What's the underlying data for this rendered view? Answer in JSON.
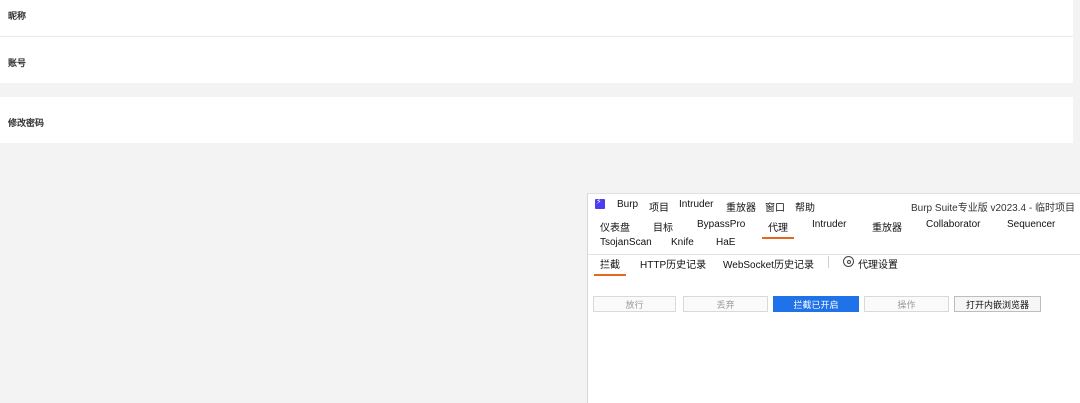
{
  "settings": {
    "nickname_label": "昵称",
    "account_label": "账号",
    "password_label": "修改密码"
  },
  "burp": {
    "logo_icon": "burp-lightning-icon",
    "menu": [
      "Burp",
      "项目",
      "Intruder",
      "重放器",
      "窗口",
      "帮助"
    ],
    "window_title": "Burp Suite专业版  v2023.4 - 临时项目",
    "tabs_row1": [
      "仪表盘",
      "目标",
      "BypassPro",
      "代理",
      "Intruder",
      "重放器",
      "Collaborator",
      "Sequencer"
    ],
    "tabs_row2": [
      "TsojanScan",
      "Knife",
      "HaE"
    ],
    "active_tab": "代理",
    "proxy_tabs": [
      "拦截",
      "HTTP历史记录",
      "WebSocket历史记录"
    ],
    "active_proxy_tab": "拦截",
    "proxy_settings_label": "代理设置",
    "proxy_settings_icon": "gear-icon",
    "buttons": {
      "forward": "放行",
      "drop": "丢弃",
      "intercept": "拦截已开启",
      "action": "操作",
      "open_browser": "打开内嵌浏览器"
    },
    "colors": {
      "accent_tab": "#e8671d",
      "intercept_on": "#1f72e8",
      "logo": "#4c3df0"
    }
  }
}
